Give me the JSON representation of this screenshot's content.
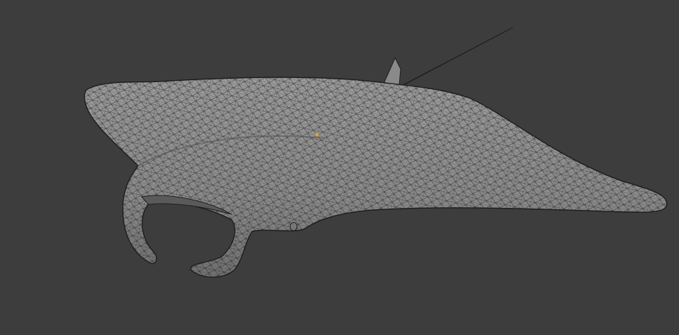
{
  "viewport": {
    "background_color": "#3d3d3d",
    "mesh_fill_color": "#8c8c8c",
    "wire_color": "#1e1e1e",
    "object_origin_color": "#e8a030",
    "object": "manta-ray-mesh",
    "shading_mode": "wireframe-overlay"
  }
}
